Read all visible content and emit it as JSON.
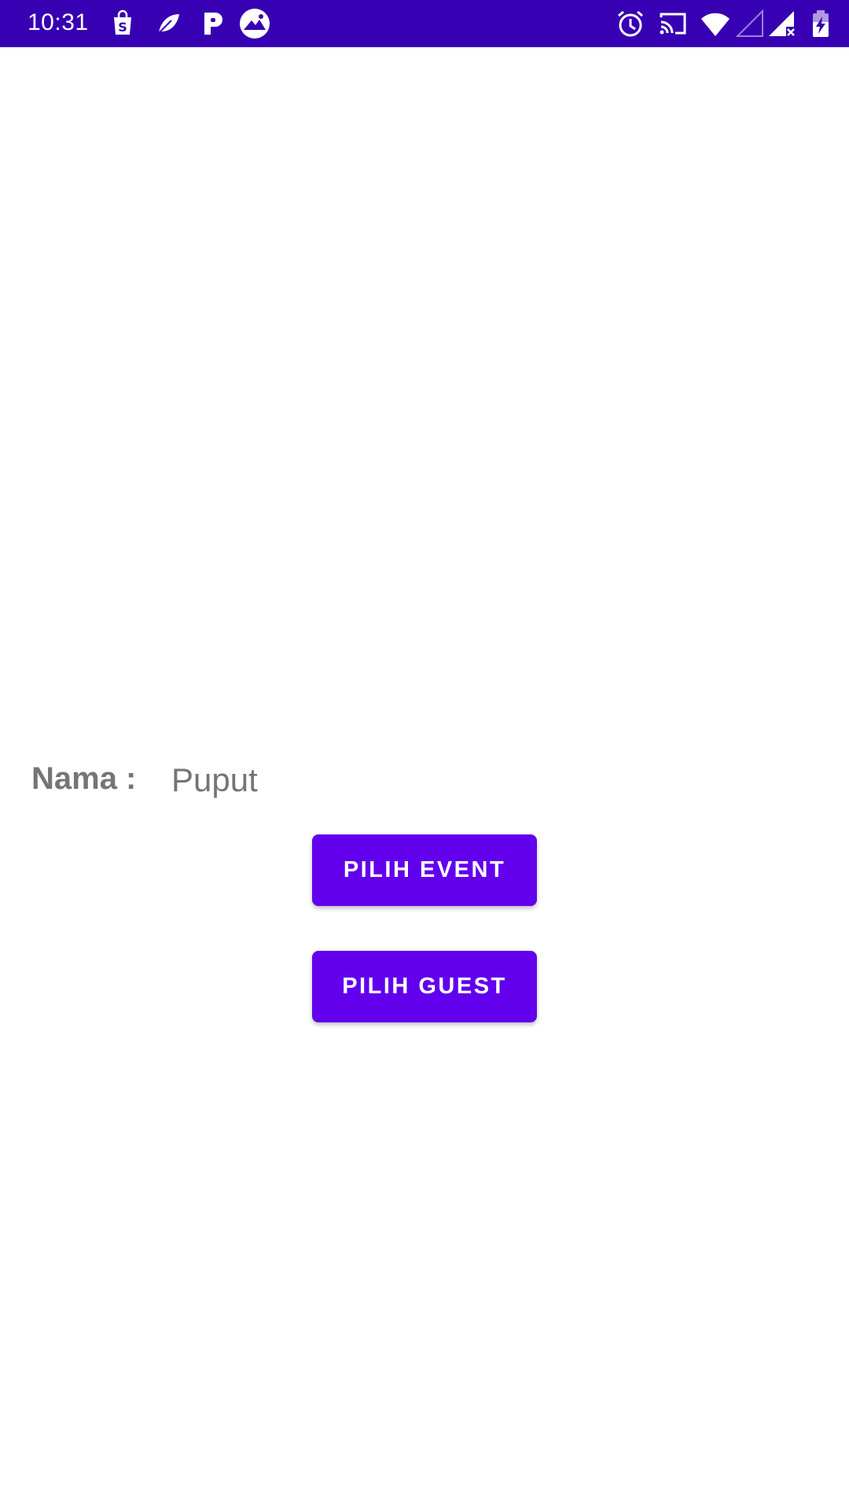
{
  "status_bar": {
    "time": "10:31",
    "background": "#3700b3",
    "notification_icons": [
      "shopee-bag-icon",
      "feather-app-icon",
      "p-app-icon",
      "mountain-app-icon"
    ],
    "system_icons": [
      "alarm-icon",
      "cast-icon",
      "wifi-icon",
      "signal-empty-icon",
      "signal-no-sim-icon",
      "battery-charging-icon"
    ]
  },
  "form": {
    "name_label": "Nama :",
    "name_value": "Puput"
  },
  "buttons": {
    "pick_event": "PILIH EVENT",
    "pick_guest": "PILIH GUEST",
    "color": "#6200ee"
  }
}
